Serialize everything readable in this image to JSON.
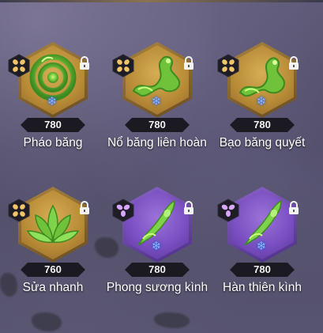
{
  "skills": [
    {
      "name": "Pháo băng",
      "score": "780",
      "rarity": "gold",
      "type_icon": "four-petal-icon",
      "art": "coil-icon",
      "element_icon": "frost-icon",
      "locked": true
    },
    {
      "name": "Nổ băng liên hoàn",
      "score": "780",
      "rarity": "gold",
      "type_icon": "four-petal-icon",
      "art": "dragon-icon",
      "element_icon": "frost-icon",
      "locked": true
    },
    {
      "name": "Bạo băng quyết",
      "score": "780",
      "rarity": "gold",
      "type_icon": "four-petal-icon",
      "art": "dragon-icon",
      "element_icon": "frost-icon",
      "locked": true
    },
    {
      "name": "Sửa nhanh",
      "score": "760",
      "rarity": "gold",
      "type_icon": "four-petal-icon",
      "art": "lotus-icon",
      "element_icon": "",
      "locked": true
    },
    {
      "name": "Phong sương kình",
      "score": "780",
      "rarity": "purple",
      "type_icon": "three-petal-icon",
      "art": "blade-icon",
      "element_icon": "frost-icon",
      "locked": true
    },
    {
      "name": "Hàn thiên kình",
      "score": "780",
      "rarity": "purple",
      "type_icon": "three-petal-icon",
      "art": "blade-icon",
      "element_icon": "frost-icon",
      "locked": true
    }
  ],
  "colors": {
    "gold_frame": "#b98c37",
    "purple_frame": "#7a4fc2",
    "jade": "#7fd34a",
    "frost": "#8fb7ff"
  }
}
